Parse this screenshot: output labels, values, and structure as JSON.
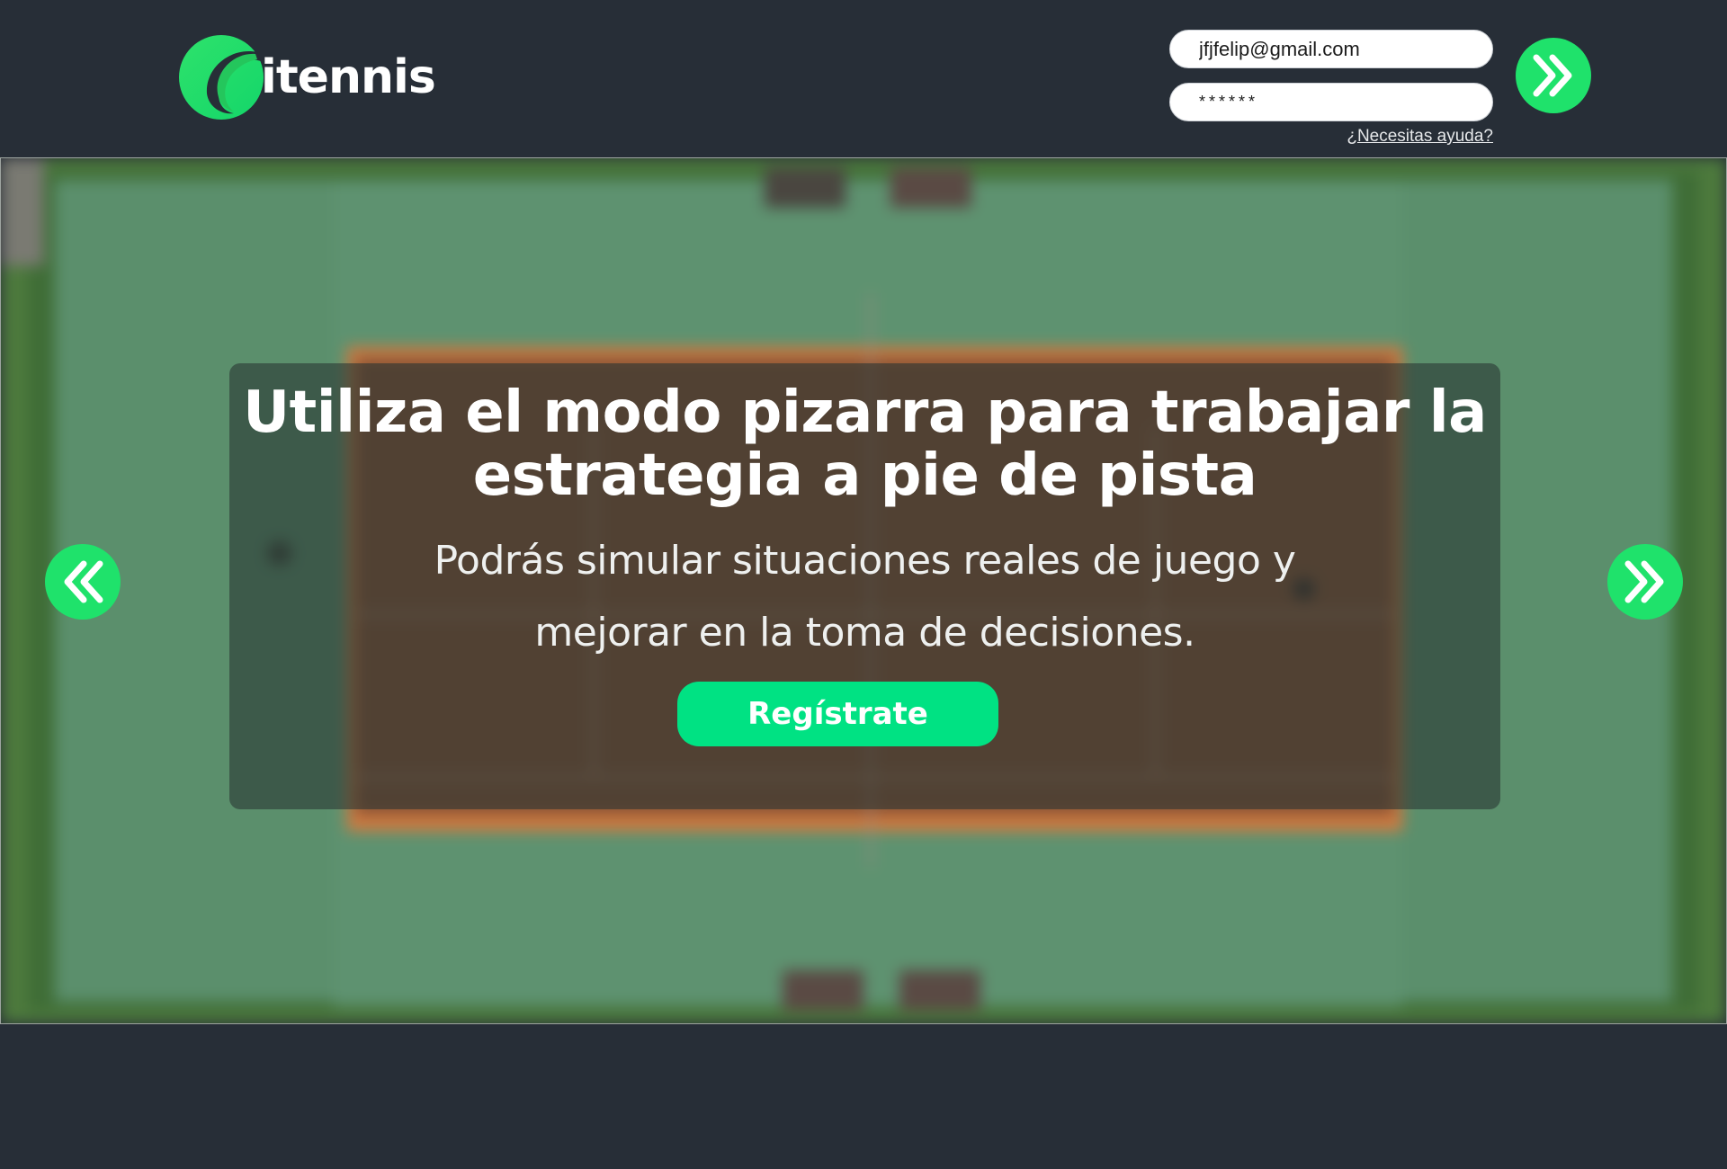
{
  "header": {
    "logo_text": "itennis",
    "login": {
      "email_value": "jfjfelip@gmail.com",
      "password_value": "******",
      "help_label": "¿Necesitas ayuda?"
    },
    "icons": {
      "submit": "double-chevron-right-icon"
    }
  },
  "hero": {
    "title": "Utiliza el modo pizarra para trabajar la estrategia a pie de pista",
    "subtitle_line1": "Podrás simular situaciones reales de juego y",
    "subtitle_line2": "mejorar en la toma de decisiones.",
    "cta_label": "Regístrate",
    "icons": {
      "prev": "double-chevron-left-icon",
      "next": "double-chevron-right-icon"
    }
  },
  "colors": {
    "background": "#272e37",
    "accent_green": "#1fe26b",
    "cta_green": "#00e283",
    "court_green": "#5f8f6e",
    "court_clay": "#c56a36"
  }
}
